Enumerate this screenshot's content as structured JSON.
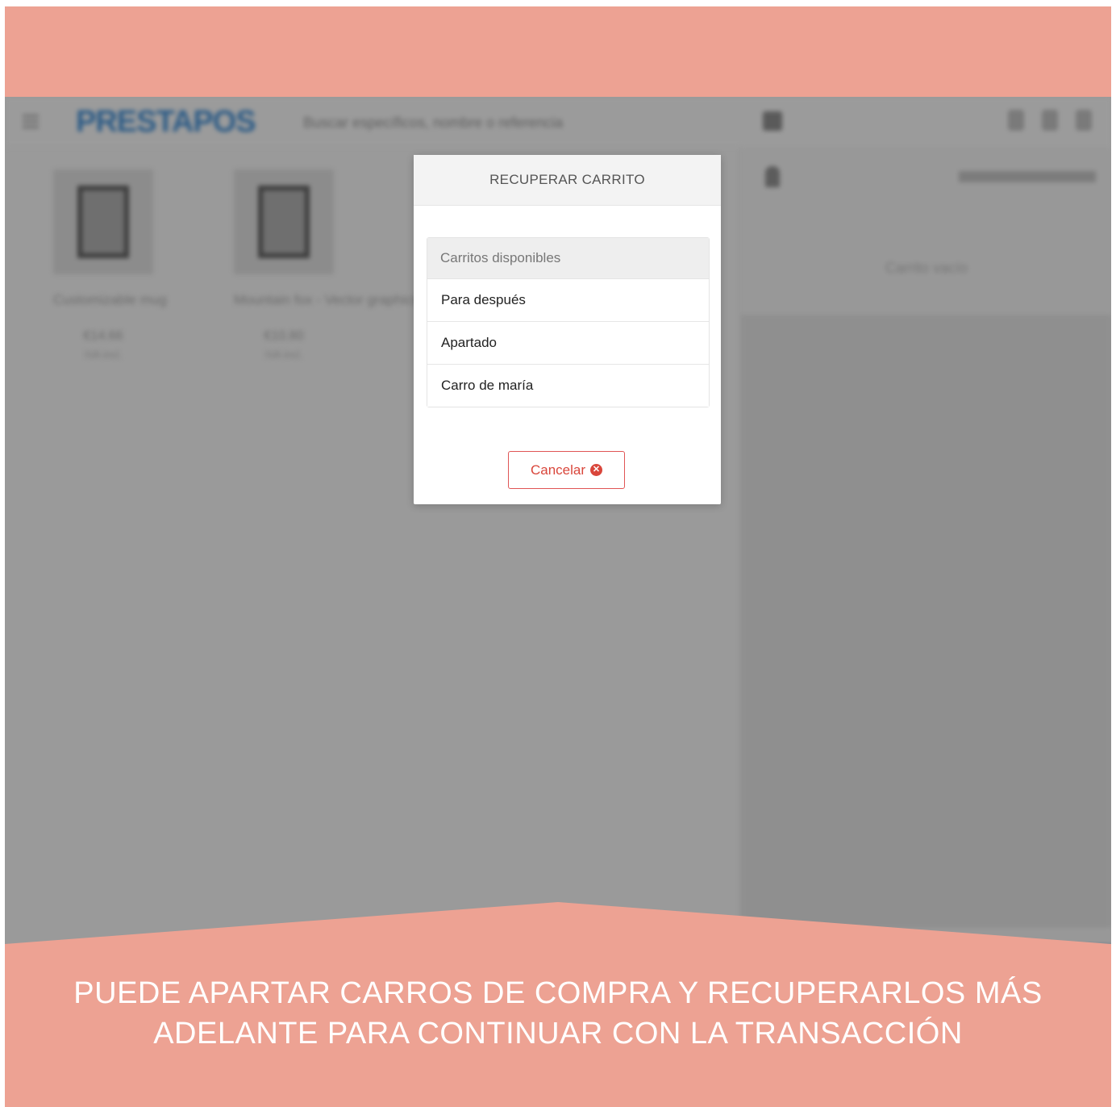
{
  "app": {
    "logo": "PRESTAPOS",
    "search_placeholder": "Buscar específicos, nombre o referencia",
    "products": [
      {
        "name": "Customizable mug",
        "price": "€14.66",
        "ref": "IVA incl."
      },
      {
        "name": "Mountain fox - Vector graphics",
        "price": "€10.80",
        "ref": "IVA incl."
      }
    ],
    "customer_add": "AGREGAR CLIENTE",
    "empty_cart": "Carrito vacío"
  },
  "modal": {
    "title": "RECUPERAR CARRITO",
    "list_header": "Carritos disponibles",
    "carts": [
      "Para después",
      "Apartado",
      "Carro de maría"
    ],
    "cancel_label": "Cancelar"
  },
  "caption": {
    "line1": "PUEDE APARTAR CARROS DE COMPRA Y RECUPERARLOS MÁS",
    "line2": "ADELANTE PARA CONTINUAR CON LA TRANSACCIÓN"
  },
  "colors": {
    "banner": "#eda293",
    "overlay": "#9a9a9a",
    "cancel": "#d9463b",
    "pay_button": "#274f74"
  }
}
